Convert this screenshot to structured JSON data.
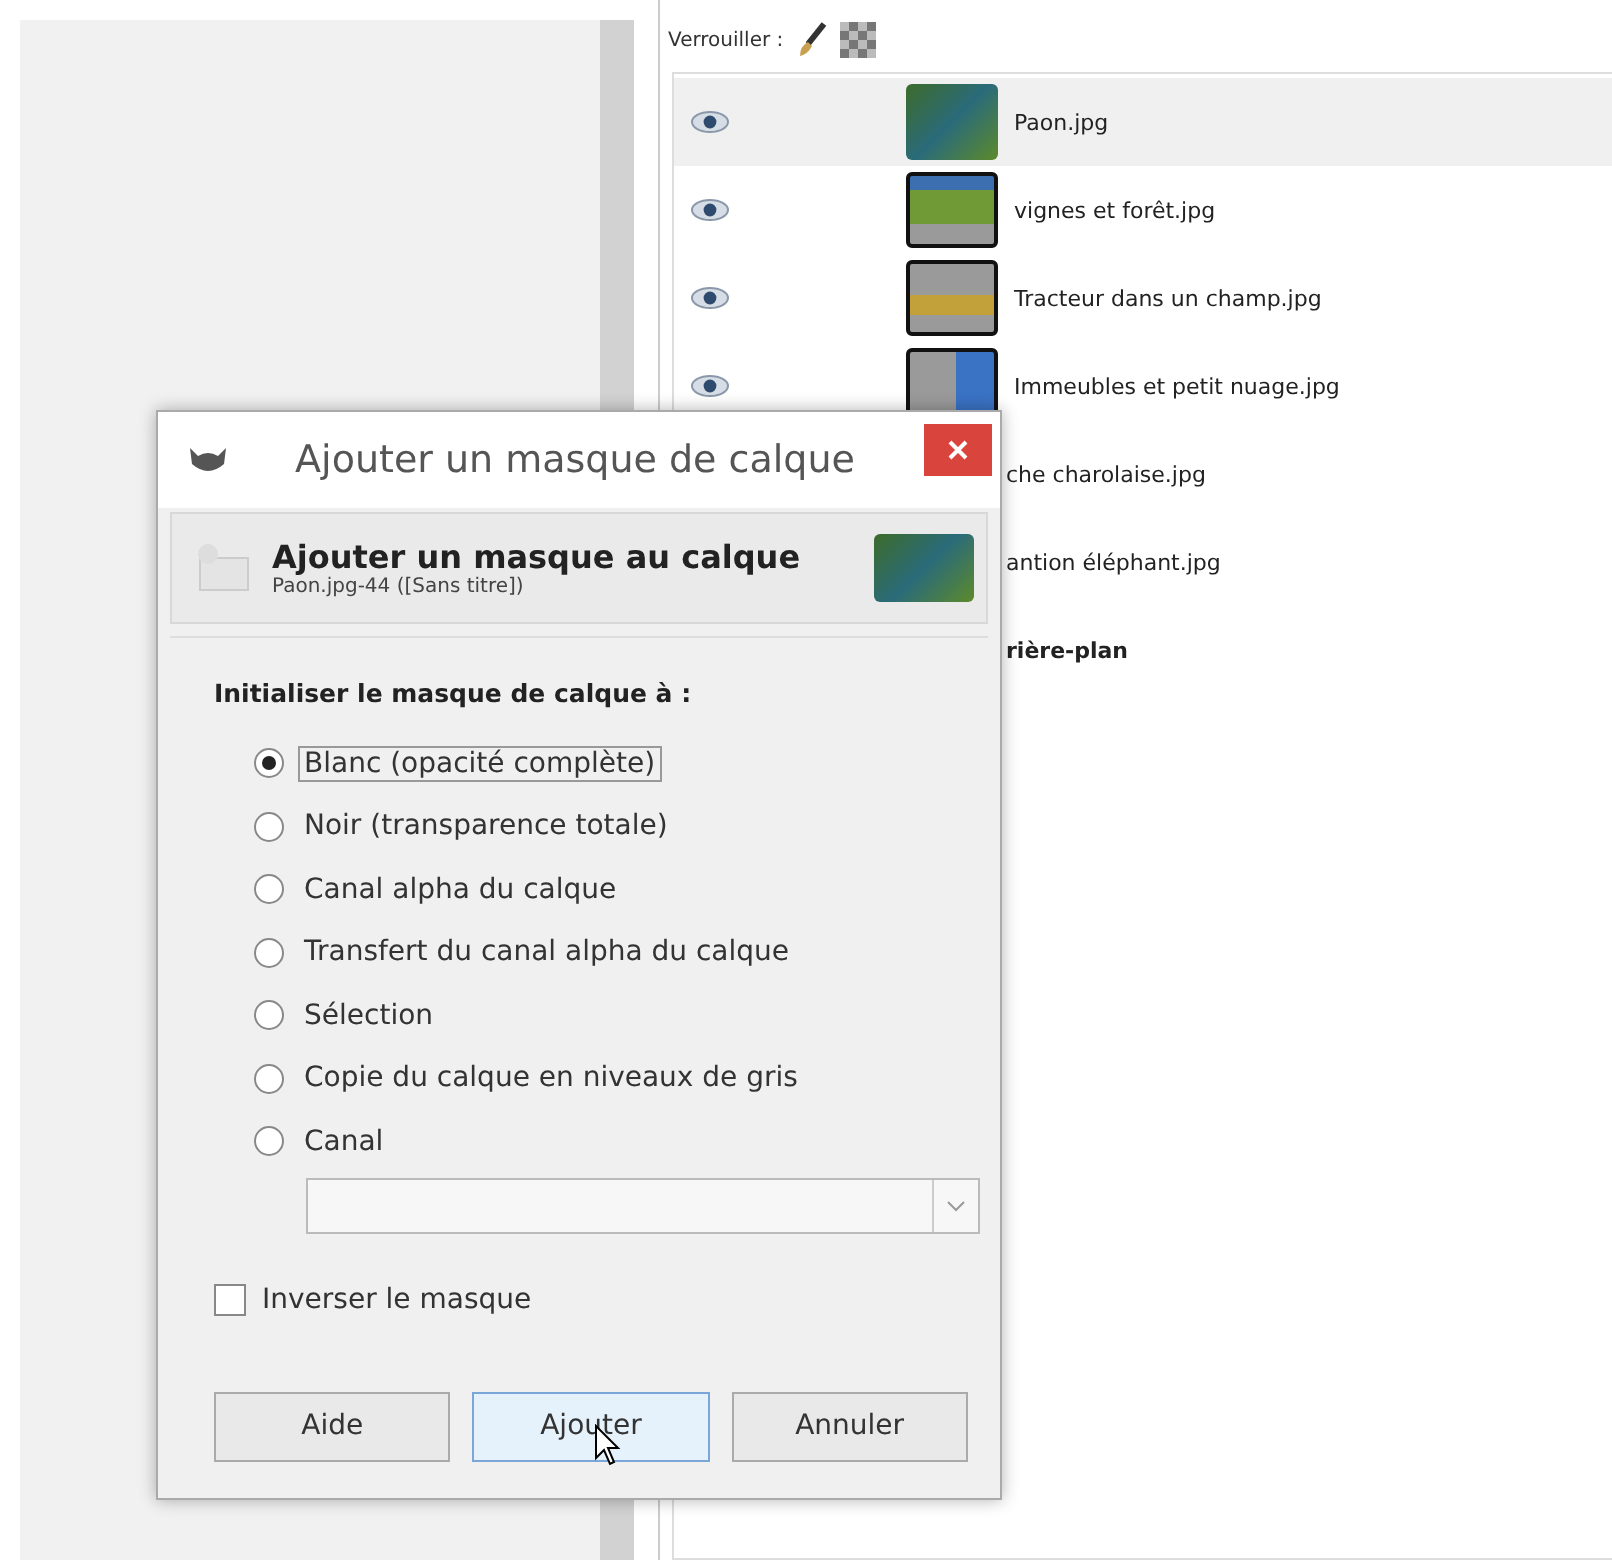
{
  "layers_panel": {
    "lock_label": "Verrouiller :",
    "layers": [
      {
        "kind": "full",
        "name": "Paon.jpg",
        "selected": true,
        "visible": true
      },
      {
        "kind": "full",
        "name": "vignes et forêt.jpg",
        "selected": false,
        "visible": true
      },
      {
        "kind": "full",
        "name": "Tracteur dans un champ.jpg",
        "selected": false,
        "visible": true
      },
      {
        "kind": "full",
        "name": "Immeubles et petit nuage.jpg",
        "selected": false,
        "visible": true
      },
      {
        "kind": "partial",
        "name": "che charolaise.jpg",
        "selected": false
      },
      {
        "kind": "partial",
        "name": "antion éléphant.jpg",
        "selected": false
      },
      {
        "kind": "partial",
        "name": "rière-plan",
        "selected": false,
        "bold": true
      }
    ]
  },
  "dialog": {
    "title": "Ajouter un masque de calque",
    "header_title": "Ajouter un masque au calque",
    "header_subtitle": "Paon.jpg-44 ([Sans titre])",
    "section_label": "Initialiser le masque de calque à :",
    "options": [
      {
        "label": "Blanc (opacité complète)",
        "selected": true
      },
      {
        "label": "Noir (transparence totale)",
        "selected": false
      },
      {
        "label": "Canal alpha du calque",
        "selected": false
      },
      {
        "label": "Transfert du canal alpha du calque",
        "selected": false
      },
      {
        "label": "Sélection",
        "selected": false
      },
      {
        "label": "Copie du calque en niveaux de gris",
        "selected": false
      },
      {
        "label": "Canal",
        "selected": false
      }
    ],
    "invert": {
      "label": "Inverser le masque",
      "checked": false
    },
    "buttons": [
      {
        "label": "Aide",
        "focused": false
      },
      {
        "label": "Ajouter",
        "focused": true
      },
      {
        "label": "Annuler",
        "focused": false
      }
    ]
  }
}
